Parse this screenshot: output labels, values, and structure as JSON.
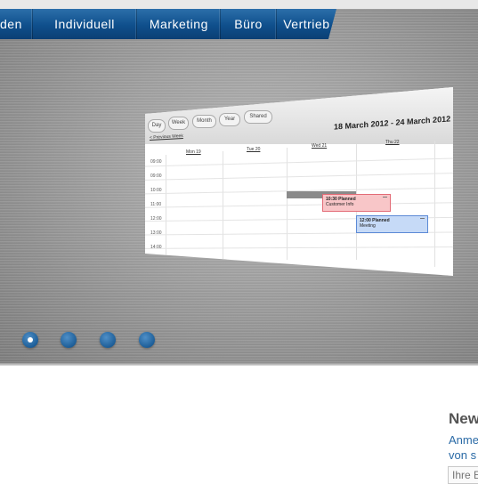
{
  "nav": {
    "items": [
      {
        "label": "den"
      },
      {
        "label": "Individuell"
      },
      {
        "label": "Marketing"
      },
      {
        "label": "Büro"
      },
      {
        "label": "Vertrieb"
      }
    ]
  },
  "calendar": {
    "views": [
      "Day",
      "Week",
      "Month",
      "Year",
      "Shared"
    ],
    "range_title": "18 March 2012 - 24 March 2012",
    "prev_week": "< Previous Week",
    "columns": [
      "Mon 19",
      "Tue 20",
      "Wed 21",
      "Thu 22"
    ],
    "hours": [
      "09:00",
      "09:00",
      "10:00",
      "11:00",
      "12:00",
      "13:00",
      "14:00"
    ],
    "events": [
      {
        "time": "10:30 Planned",
        "title": "Customer Info",
        "color": "#f8c6c8"
      },
      {
        "time": "12:00 Planned",
        "title": "Meeting",
        "color": "#c6daf7"
      }
    ]
  },
  "slider": {
    "dots": 4,
    "active_index": 0
  },
  "newsletter": {
    "title": "New",
    "line1": "Anme",
    "line2": "von s",
    "input_placeholder": "Ihre E"
  },
  "colors": {
    "nav_blue": "#0f4f8c",
    "dot_blue": "#1d5e98",
    "link_blue": "#2a6aa6"
  }
}
